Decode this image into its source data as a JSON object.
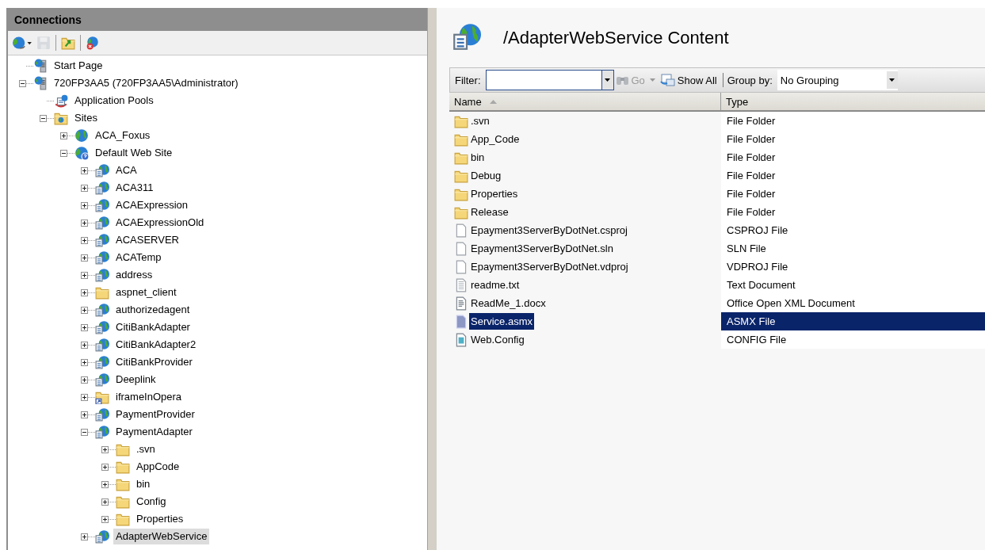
{
  "connections": {
    "title": "Connections",
    "toolbar": [
      {
        "kind": "connect",
        "disabled": false
      },
      {
        "kind": "save",
        "disabled": true
      },
      {
        "kind": "up",
        "disabled": false
      },
      {
        "kind": "disconnect",
        "disabled": false
      }
    ],
    "tree": [
      {
        "label": "Start Page",
        "kind": "server",
        "selected": false
      },
      {
        "label": "720FP3AA5 (720FP3AA5\\Administrator)",
        "kind": "server",
        "expanded": true,
        "selected": false,
        "children": [
          {
            "label": "Application Pools",
            "kind": "app-pools",
            "selected": false
          },
          {
            "label": "Sites",
            "kind": "sites",
            "expanded": true,
            "selected": false,
            "children": [
              {
                "label": "ACA_Foxus",
                "kind": "globe",
                "expanded": false,
                "selected": false
              },
              {
                "label": "Default Web Site",
                "kind": "default-site",
                "expanded": true,
                "selected": false,
                "children": [
                  {
                    "label": "ACA",
                    "kind": "app",
                    "expanded": false,
                    "selected": false
                  },
                  {
                    "label": "ACA311",
                    "kind": "app",
                    "expanded": false,
                    "selected": false
                  },
                  {
                    "label": "ACAExpression",
                    "kind": "app",
                    "expanded": false,
                    "selected": false
                  },
                  {
                    "label": "ACAExpressionOld",
                    "kind": "app",
                    "expanded": false,
                    "selected": false
                  },
                  {
                    "label": "ACASERVER",
                    "kind": "app",
                    "expanded": false,
                    "selected": false
                  },
                  {
                    "label": "ACATemp",
                    "kind": "app",
                    "expanded": false,
                    "selected": false
                  },
                  {
                    "label": "address",
                    "kind": "app",
                    "expanded": false,
                    "selected": false
                  },
                  {
                    "label": "aspnet_client",
                    "kind": "folder",
                    "expanded": false,
                    "selected": false
                  },
                  {
                    "label": "authorizedagent",
                    "kind": "app",
                    "expanded": false,
                    "selected": false
                  },
                  {
                    "label": "CitiBankAdapter",
                    "kind": "app",
                    "expanded": false,
                    "selected": false
                  },
                  {
                    "label": "CitiBankAdapter2",
                    "kind": "app",
                    "expanded": false,
                    "selected": false
                  },
                  {
                    "label": "CitiBankProvider",
                    "kind": "app",
                    "expanded": false,
                    "selected": false
                  },
                  {
                    "label": "Deeplink",
                    "kind": "app",
                    "expanded": false,
                    "selected": false
                  },
                  {
                    "label": "iframeInOpera",
                    "kind": "folder-link",
                    "expanded": false,
                    "selected": false
                  },
                  {
                    "label": "PaymentProvider",
                    "kind": "app",
                    "expanded": false,
                    "selected": false
                  },
                  {
                    "label": "PaymentAdapter",
                    "kind": "app",
                    "expanded": true,
                    "selected": false,
                    "children": [
                      {
                        "label": ".svn",
                        "kind": "folder",
                        "expanded": false,
                        "selected": false
                      },
                      {
                        "label": "AppCode",
                        "kind": "folder",
                        "expanded": false,
                        "selected": false
                      },
                      {
                        "label": "bin",
                        "kind": "folder",
                        "expanded": false,
                        "selected": false
                      },
                      {
                        "label": "Config",
                        "kind": "folder",
                        "expanded": false,
                        "selected": false
                      },
                      {
                        "label": "Properties",
                        "kind": "folder",
                        "expanded": false,
                        "selected": false
                      }
                    ]
                  },
                  {
                    "label": "AdapterWebService",
                    "kind": "app",
                    "expanded": false,
                    "selected": true
                  }
                ]
              }
            ]
          }
        ]
      }
    ]
  },
  "content": {
    "title": "/AdapterWebService Content",
    "filter": {
      "label": "Filter:"
    },
    "go": {
      "label": "Go",
      "disabled": true
    },
    "show_all": {
      "label": "Show All"
    },
    "group_by": {
      "label": "Group by:",
      "value": "No Grouping"
    },
    "columns": [
      {
        "label": "Name",
        "sorted": true
      },
      {
        "label": "Type",
        "sorted": false
      }
    ],
    "rows": [
      {
        "kind": "folder",
        "name": ".svn",
        "type": "File Folder",
        "selected": false
      },
      {
        "kind": "folder",
        "name": "App_Code",
        "type": "File Folder",
        "selected": false
      },
      {
        "kind": "folder",
        "name": "bin",
        "type": "File Folder",
        "selected": false
      },
      {
        "kind": "folder",
        "name": "Debug",
        "type": "File Folder",
        "selected": false
      },
      {
        "kind": "folder",
        "name": "Properties",
        "type": "File Folder",
        "selected": false
      },
      {
        "kind": "folder",
        "name": "Release",
        "type": "File Folder",
        "selected": false
      },
      {
        "kind": "file",
        "name": "Epayment3ServerByDotNet.csproj",
        "type": "CSPROJ File",
        "selected": false
      },
      {
        "kind": "file",
        "name": "Epayment3ServerByDotNet.sln",
        "type": "SLN File",
        "selected": false
      },
      {
        "kind": "file",
        "name": "Epayment3ServerByDotNet.vdproj",
        "type": "VDPROJ File",
        "selected": false
      },
      {
        "kind": "text",
        "name": "readme.txt",
        "type": "Text Document",
        "selected": false
      },
      {
        "kind": "doc",
        "name": "ReadMe_1.docx",
        "type": "Office Open XML Document",
        "selected": false
      },
      {
        "kind": "asmx",
        "name": "Service.asmx",
        "type": "ASMX File",
        "selected": true
      },
      {
        "kind": "config",
        "name": "Web.Config",
        "type": "CONFIG File",
        "selected": false
      }
    ]
  }
}
